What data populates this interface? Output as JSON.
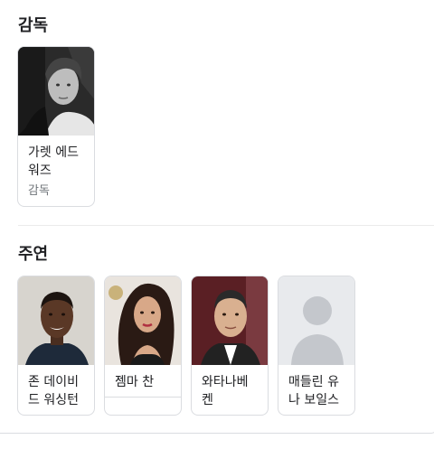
{
  "director_section": {
    "title": "감독",
    "people": [
      {
        "name_line1": "가렛 에드",
        "name_line2": "워즈",
        "role": "감독"
      }
    ]
  },
  "cast_section": {
    "title": "주연",
    "people": [
      {
        "name_line1": "존 데이비",
        "name_line2": "드 워싱턴"
      },
      {
        "name_line1": "젬마 찬",
        "name_line2": ""
      },
      {
        "name_line1": "와타나베",
        "name_line2": "켄"
      },
      {
        "name_line1": "매들린 유",
        "name_line2": "나 보일스"
      }
    ]
  },
  "colors": {
    "card_border": "#dadce0",
    "secondary_text": "#70757a",
    "placeholder_bg": "#e8eaed",
    "placeholder_figure": "#c4c7cc"
  }
}
